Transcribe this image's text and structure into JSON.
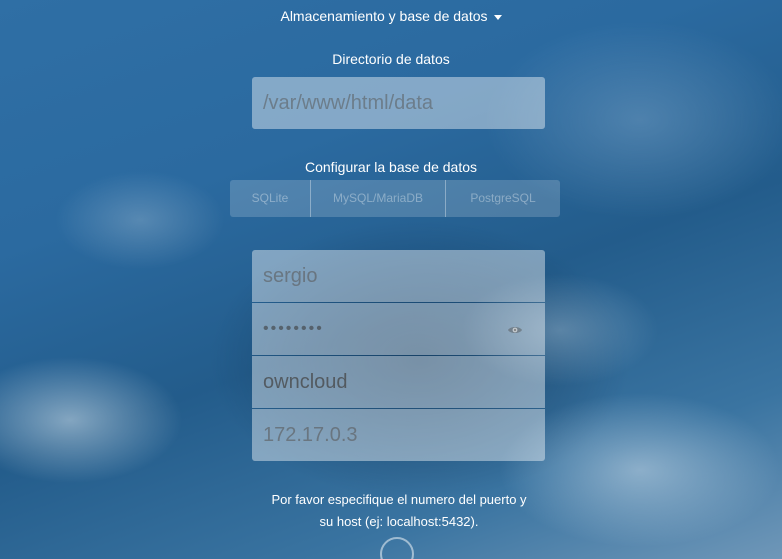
{
  "storage_toggle": {
    "label": "Almacenamiento y base de datos",
    "icon": "caret-down-icon"
  },
  "data_directory": {
    "label": "Directorio de datos",
    "placeholder": "/var/www/html/data"
  },
  "database": {
    "label": "Configurar la base de datos",
    "options": [
      "SQLite",
      "MySQL/MariaDB",
      "PostgreSQL"
    ],
    "user": "sergio",
    "password_mask": "••••••••",
    "name": "owncloud",
    "host": "172.17.0.3",
    "password_icon": "eye-icon"
  },
  "hint": {
    "line1": "Por favor especifique el numero del puerto y",
    "line2": "su host (ej: localhost:5432)."
  },
  "colors": {
    "text": "#ffffff",
    "background": "#2b6aa0"
  }
}
